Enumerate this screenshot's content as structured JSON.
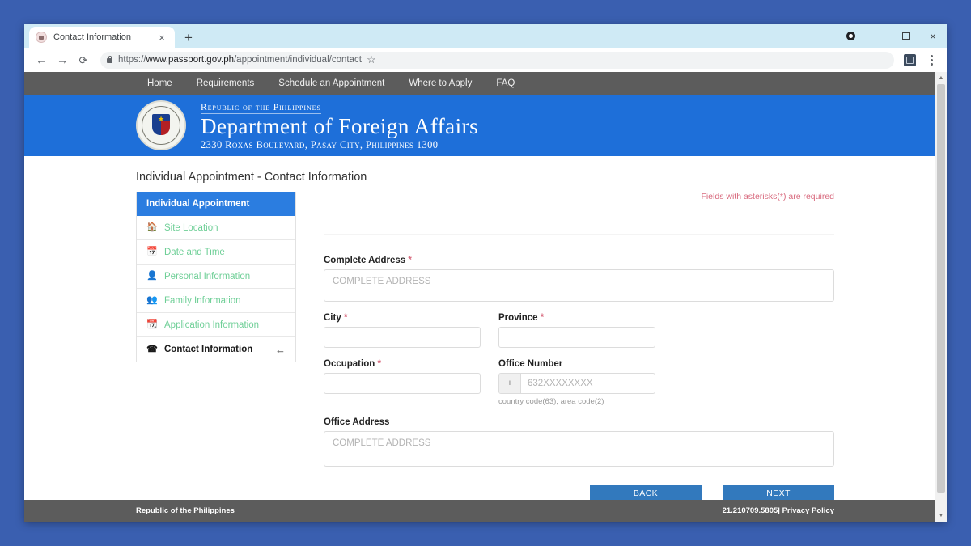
{
  "browser": {
    "tab": {
      "title": "Contact Information",
      "close_label": "×",
      "favicon": "site-favicon"
    },
    "new_tab_label": "+",
    "window_controls": {
      "profile": "profile-avatar",
      "minimize": "–",
      "maximize": "□",
      "close": "×"
    },
    "nav": {
      "back": "←",
      "forward": "→",
      "reload": "⟳"
    },
    "omnibox": {
      "lock": "lock-icon",
      "scheme": "https://",
      "host": "www.passport.gov.ph",
      "path": "/appointment/individual/contact",
      "star": "☆"
    },
    "extension_icon": "extension-icon",
    "menu": "⋮"
  },
  "site_nav": {
    "items": [
      {
        "label": "Home"
      },
      {
        "label": "Requirements"
      },
      {
        "label": "Schedule an Appointment"
      },
      {
        "label": "Where to Apply"
      },
      {
        "label": "FAQ"
      }
    ]
  },
  "banner": {
    "seal_alt": "dfa-seal",
    "line1": "Republic of the Philippines",
    "line2": "Department of Foreign Affairs",
    "line3": "2330 Roxas Boulevard, Pasay City, Philippines 1300"
  },
  "page": {
    "title": "Individual Appointment - Contact Information",
    "required_note": "Fields with asterisks(*) are required"
  },
  "steps": {
    "header": "Individual Appointment",
    "items": [
      {
        "label": "Site Location",
        "icon": "home-icon",
        "glyph": "⌂",
        "state": "done"
      },
      {
        "label": "Date and Time",
        "icon": "calendar-icon",
        "glyph": "▦",
        "state": "done"
      },
      {
        "label": "Personal Information",
        "icon": "user-icon",
        "glyph": "♟",
        "state": "done"
      },
      {
        "label": "Family Information",
        "icon": "users-icon",
        "glyph": "♟♟",
        "state": "done"
      },
      {
        "label": "Application Information",
        "icon": "calendar-alt-icon",
        "glyph": "▤",
        "state": "done"
      },
      {
        "label": "Contact Information",
        "icon": "phone-icon",
        "glyph": "☎",
        "state": "active",
        "arrow": "←"
      }
    ]
  },
  "form": {
    "complete_address": {
      "label": "Complete Address",
      "required": "*",
      "placeholder": "COMPLETE ADDRESS",
      "value": ""
    },
    "city": {
      "label": "City",
      "required": "*",
      "placeholder": "",
      "value": ""
    },
    "province": {
      "label": "Province",
      "required": "*",
      "placeholder": "",
      "value": ""
    },
    "occupation": {
      "label": "Occupation",
      "required": "*",
      "placeholder": "",
      "value": ""
    },
    "office_number": {
      "label": "Office Number",
      "required": "",
      "prefix": "+",
      "placeholder": "632XXXXXXXX",
      "value": "",
      "helper": "country code(63), area code(2)"
    },
    "office_address": {
      "label": "Office Address",
      "required": "",
      "placeholder": "COMPLETE ADDRESS",
      "value": ""
    },
    "back_button": "BACK",
    "next_button": "NEXT"
  },
  "footer": {
    "left": "Republic of the Philippines",
    "version": "21.210709.5805|",
    "privacy": "Privacy Policy"
  },
  "scrollbar": {
    "up": "▲",
    "down": "▼"
  },
  "colors": {
    "accent_blue": "#1e6fd9",
    "step_header_blue": "#2b7de0",
    "button_blue": "#3279bd",
    "nav_gray": "#5c5c5c",
    "done_green": "#6fcf97",
    "required_red": "#d86a7e",
    "desktop_blue": "#3a5fb0"
  }
}
